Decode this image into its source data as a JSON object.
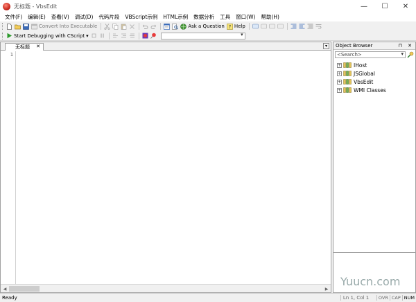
{
  "window": {
    "title": "无标题 - VbsEdit",
    "minimize": "—",
    "maximize": "☐",
    "close": "✕"
  },
  "menu": [
    "文件(F)",
    "编辑(E)",
    "查看(V)",
    "调试(D)",
    "代码片段",
    "VBScript示例",
    "HTML示例",
    "数据分析",
    "工具",
    "窗口(W)",
    "帮助(H)"
  ],
  "toolbar": {
    "convert_label": "Convert Into Executable",
    "ask_label": "Ask a Question",
    "help_label": "Help",
    "debug_label": "Start Debugging with CScript"
  },
  "editor": {
    "tab_label": "无标题",
    "tab_close": "✕",
    "line_numbers": [
      "1"
    ]
  },
  "object_browser": {
    "title": "Object Browser",
    "header_buttons": "⊓ ✕",
    "search_placeholder": "<Search>",
    "items": [
      {
        "label": "IHost"
      },
      {
        "label": "JSGlobal"
      },
      {
        "label": "VbsEdit"
      },
      {
        "label": "WMI Classes"
      }
    ]
  },
  "status": {
    "text": "Ready",
    "position": "Ln 1, Col 1",
    "ovr": "OVR",
    "cap": "CAP",
    "num": "NUM"
  },
  "watermark": "Yuucn.com",
  "colors": {
    "accent": "#c8281e",
    "folder": "#e2c45a",
    "chrome": "#f0f0f0"
  }
}
